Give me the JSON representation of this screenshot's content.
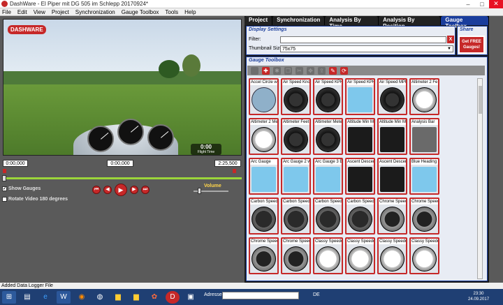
{
  "window": {
    "title": "DashWare - El Piper mit DG 505 im Schlepp 20170924*",
    "min": "–",
    "max": "□",
    "close": "✕"
  },
  "menu": [
    "File",
    "Edit",
    "View",
    "Project",
    "Synchronization",
    "Gauge Toolbox",
    "Tools",
    "Help"
  ],
  "video": {
    "logo": "DASHWARE",
    "flight_time": "0:00",
    "flight_label": "Flight Time"
  },
  "timeline": {
    "start": "0:00,000",
    "current": "0:00,000",
    "end": "2:25,500"
  },
  "options": {
    "show_gauges": "Show Gauges",
    "rotate_video": "Rotate Video 180 degrees",
    "volume": "Volume"
  },
  "playback": {
    "prev": "⏮",
    "rew": "◀",
    "play": "▶",
    "fwd": "▶",
    "next": "⏭"
  },
  "tabs": [
    "Project",
    "Synchronization",
    "Analysis By Time",
    "Analysis By Position",
    "Gauge Toolbox"
  ],
  "display_settings": {
    "title": "Display Settings",
    "filter_label": "Filter:",
    "filter_value": "",
    "clear": "X",
    "thumb_label": "Thumbnail Size:",
    "thumb_value": "75x75"
  },
  "share": {
    "title": "Share",
    "button": "Get FREE Gauges!"
  },
  "toolbox": {
    "title": "Gauge Toolbox"
  },
  "gauges": [
    {
      "name": "Accel Circle wi",
      "style": "acc"
    },
    {
      "name": "Air Speed Kno",
      "style": "round"
    },
    {
      "name": "Air Speed KPH",
      "style": "round"
    },
    {
      "name": "Air Speed KPH",
      "style": "blue"
    },
    {
      "name": "Air Speed MPH",
      "style": "round"
    },
    {
      "name": "Altimeter 2 Fe",
      "style": "white"
    },
    {
      "name": "Altimeter 2 Me",
      "style": "white"
    },
    {
      "name": "Altimeter Feet",
      "style": "round"
    },
    {
      "name": "Altimeter Mete",
      "style": "round"
    },
    {
      "name": "Altitude Min M",
      "style": "dark"
    },
    {
      "name": "Altitude Min M",
      "style": "dark"
    },
    {
      "name": "Analysis Bar",
      "style": "grey"
    },
    {
      "name": "Arc Gauge",
      "style": "blue"
    },
    {
      "name": "Arc Gauge 2 w",
      "style": "blue"
    },
    {
      "name": "Arc Gauge 3 E",
      "style": "blue"
    },
    {
      "name": "Ascent Descer",
      "style": "dark"
    },
    {
      "name": "Ascent Descer",
      "style": "dark"
    },
    {
      "name": "Blue Heading",
      "style": "blue"
    },
    {
      "name": "Carbon Speed",
      "style": "carbon"
    },
    {
      "name": "Carbon Speed",
      "style": "carbon"
    },
    {
      "name": "Carbon Speed",
      "style": "carbon"
    },
    {
      "name": "Carbon Speed",
      "style": "carbon"
    },
    {
      "name": "Chrome Speec",
      "style": "crm"
    },
    {
      "name": "Chrome Speec",
      "style": "crm"
    },
    {
      "name": "Chrome Speec",
      "style": "crm"
    },
    {
      "name": "Chrome Speec",
      "style": "crm"
    },
    {
      "name": "Classy Speedo",
      "style": "white"
    },
    {
      "name": "Classy Speedo",
      "style": "white"
    },
    {
      "name": "Classy Speedo",
      "style": "white"
    },
    {
      "name": "Classy Speedo",
      "style": "white"
    }
  ],
  "status": "Added Data Logger File",
  "taskbar": {
    "address_label": "Adresse",
    "lang": "DE",
    "time": "23:30",
    "date": "24.09.2017"
  },
  "colors": {
    "accent_red": "#c62828",
    "tab_blue": "#1a3d9c",
    "track_green": "#9bd53a"
  }
}
